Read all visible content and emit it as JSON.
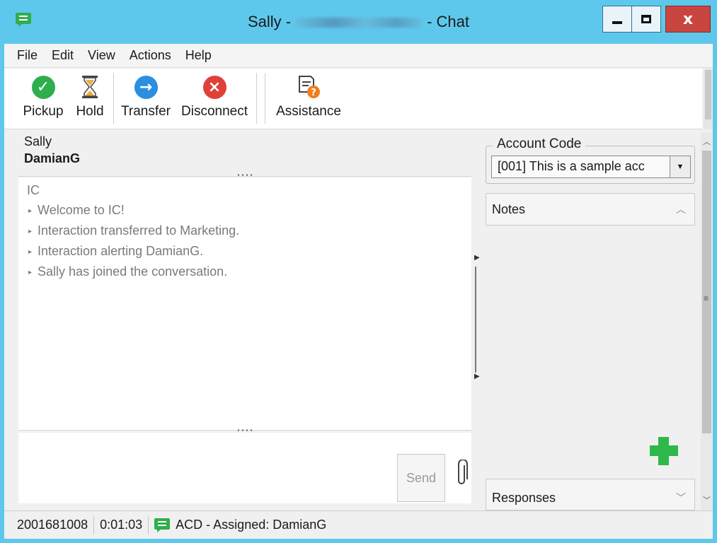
{
  "window": {
    "title_prefix": "Sally -",
    "title_suffix": "- Chat",
    "minimize_icon": "minimize-icon",
    "maximize_icon": "maximize-icon",
    "close_label": "x",
    "accent_color": "#5ec8ec"
  },
  "menu": {
    "items": [
      "File",
      "Edit",
      "View",
      "Actions",
      "Help"
    ]
  },
  "toolbar": {
    "buttons": [
      {
        "label": "Pickup",
        "icon": "check-circle-icon",
        "color": "#2fae4e"
      },
      {
        "label": "Hold",
        "icon": "hourglass-icon"
      },
      {
        "label": "Transfer",
        "icon": "arrow-right-circle-icon",
        "color": "#2a8fe0"
      },
      {
        "label": "Disconnect",
        "icon": "x-circle-icon",
        "color": "#e0403a"
      },
      {
        "label": "Assistance",
        "icon": "help-document-icon"
      }
    ]
  },
  "chat": {
    "participants": [
      "Sally",
      "DamianG"
    ],
    "sender": "IC",
    "messages": [
      "Welcome to IC!",
      "Interaction transferred to Marketing.",
      "Interaction alerting DamianG.",
      "Sally has joined the conversation."
    ],
    "send_label": "Send"
  },
  "right_panel": {
    "account_code_label": "Account Code",
    "account_code_value": "[001]  This is a sample acc",
    "notes_label": "Notes",
    "responses_label": "Responses"
  },
  "status": {
    "interaction_id": "2001681008",
    "elapsed": "0:01:03",
    "state": "ACD - Assigned: DamianG"
  }
}
